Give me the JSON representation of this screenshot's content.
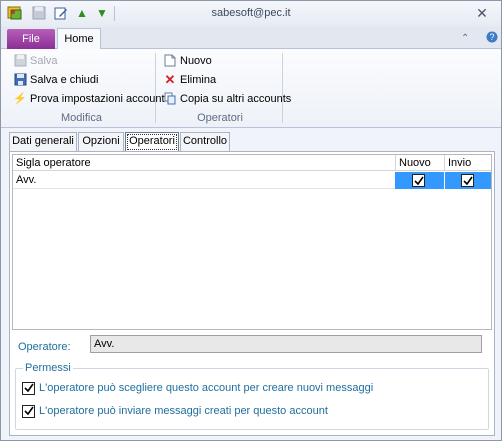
{
  "window": {
    "title": "sabesoft@pec.it",
    "close_glyph": "✕"
  },
  "quick_access": {
    "icons": [
      "app-icon",
      "save-icon",
      "edit-icon",
      "up-arrow-icon",
      "down-arrow-icon"
    ]
  },
  "ribbon_tabs": {
    "file": "File",
    "home": "Home"
  },
  "ribbon": {
    "modifica": {
      "label": "Modifica",
      "salva": "Salva",
      "salva_chiudi": "Salva e chiudi",
      "prova": "Prova impostazioni account"
    },
    "operatori": {
      "label": "Operatori",
      "nuovo": "Nuovo",
      "elimina": "Elimina",
      "copia": "Copia su altri accounts"
    }
  },
  "content_tabs": [
    "Dati generali",
    "Opzioni",
    "Operatori",
    "Controllo"
  ],
  "active_tab": "Operatori",
  "grid": {
    "columns": [
      "Sigla operatore",
      "Nuovo",
      "Invio"
    ],
    "rows": [
      {
        "sigla": "Avv.",
        "nuovo": true,
        "invio": true
      }
    ]
  },
  "operatore": {
    "label": "Operatore:",
    "value": "Avv."
  },
  "permessi": {
    "legend": "Permessi",
    "items": [
      {
        "label": "L'operatore può scegliere questo account per creare nuovi messaggi",
        "checked": true
      },
      {
        "label": "L'operatore può inviare messaggi creati per questo account",
        "checked": true
      }
    ]
  },
  "colors": {
    "file_tab": "#9a3fa3",
    "selection": "#3399ff",
    "label_blue": "#1f6e9e"
  }
}
